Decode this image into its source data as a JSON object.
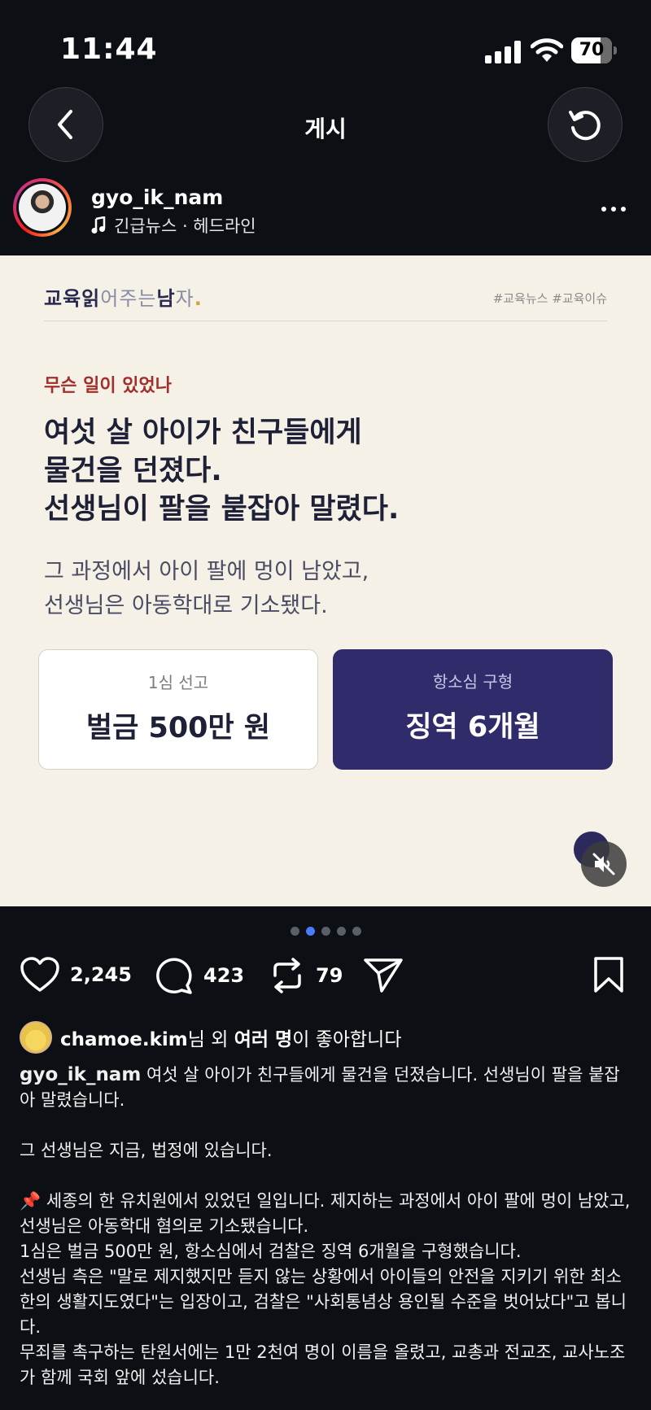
{
  "status_bar": {
    "time": "11:44",
    "battery": "70"
  },
  "nav": {
    "title": "게시",
    "back_icon": "chevron-left-icon",
    "refresh_icon": "refresh-icon"
  },
  "post": {
    "username": "gyo_ik_nam",
    "music": "긴급뉴스 · 헤드라인"
  },
  "card": {
    "brand_parts": [
      "교육",
      "읽",
      "어주는",
      "남",
      "자",
      "."
    ],
    "tags": "#교육뉴스 #교육이슈",
    "kicker": "무슨 일이 있었나",
    "headline_lines": [
      "여섯 살 아이가 친구들에게",
      "물건을 던졌다.",
      "선생님이 팔을 붙잡아 말렸다."
    ],
    "subline_lines": [
      "그 과정에서 아이 팔에 멍이 남았고,",
      "선생님은 아동학대로 기소됐다."
    ],
    "box_left": {
      "label": "1심 선고",
      "value": "벌금 500만 원"
    },
    "box_right": {
      "label": "항소심 구형",
      "value": "징역 6개월"
    }
  },
  "carousel": {
    "total": 5,
    "active": 2
  },
  "actions": {
    "likes": "2,245",
    "comments": "423",
    "reposts": "79"
  },
  "liked_by": {
    "user": "chamoe.kim",
    "suffix1": "님 외 ",
    "bold2": "여러 명",
    "suffix2": "이 좋아합니다"
  },
  "caption": {
    "user": "gyo_ik_nam",
    "first": " 여섯 살 아이가 친구들에게 물건을 던졌습니다. 선생님이 팔을 붙잡아 말렸습니다.",
    "line2": "그 선생님은 지금, 법정에 있습니다.",
    "line3": "📌 세종의 한 유치원에서 있었던 일입니다. 제지하는 과정에서 아이 팔에 멍이 남았고, 선생님은 아동학대 혐의로 기소됐습니다.",
    "line4": "1심은 벌금 500만 원, 항소심에서 검찰은 징역 6개월을 구형했습니다.",
    "line5": "선생님 측은 \"말로 제지했지만 듣지 않는 상황에서 아이들의 안전을 지키기 위한 최소한의 생활지도였다\"는 입장이고, 검찰은 \"사회통념상 용인될 수준을 벗어났다\"고 봅니다.",
    "line6": "무죄를 촉구하는 탄원서에는 1만 2천여 명이 이름을 올렸고, 교총과 전교조, 교사노조가 함께 국회 앞에 섰습니다."
  },
  "colors": {
    "card_bg": "#f5f1e6",
    "navy": "#302c6b",
    "kicker_red": "#a0302c",
    "active_dot": "#4a7cff"
  }
}
